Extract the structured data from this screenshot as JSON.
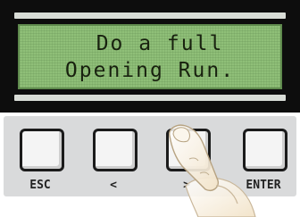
{
  "display": {
    "line1": "Do a full",
    "line2": "Opening Run."
  },
  "keys": {
    "esc": "ESC",
    "left": "<",
    "right": ">",
    "enter": "ENTER"
  },
  "colors": {
    "lcd_background": "#8fbf78",
    "lcd_text": "#18210f",
    "module_frame": "#0d0d0d",
    "keypad_plate": "#d9dadb"
  },
  "icons": {
    "pressing_finger": "finger-pointer-icon"
  }
}
